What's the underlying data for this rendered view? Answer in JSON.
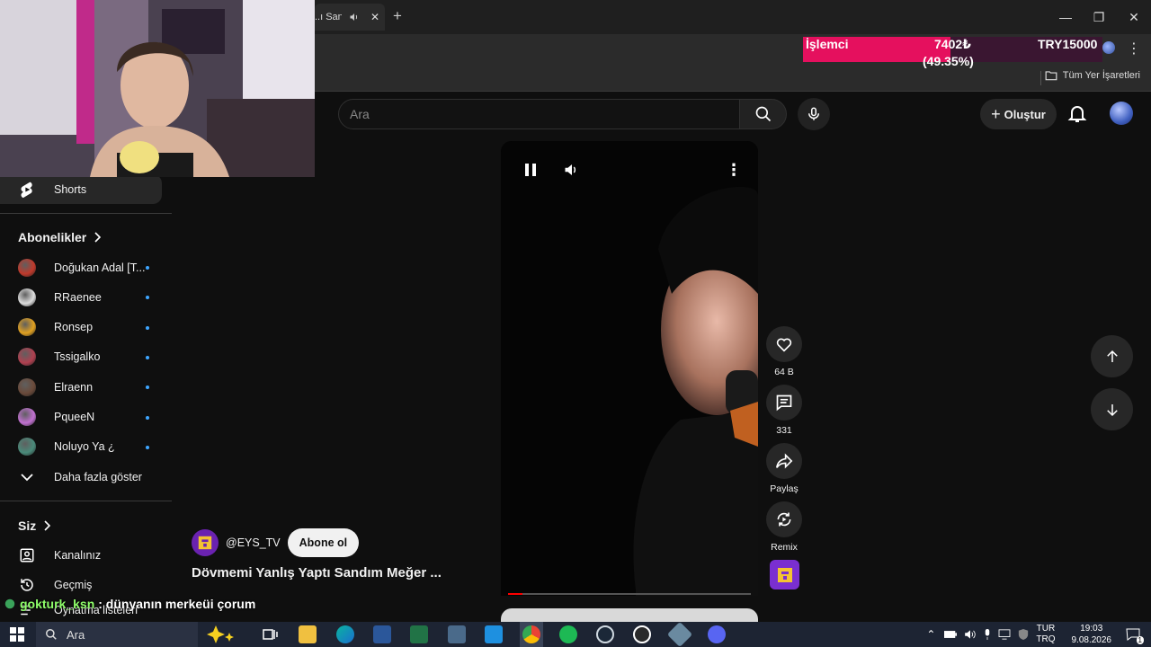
{
  "browser": {
    "tab_title": "..ı Sandı",
    "new_tab": "+",
    "minimize": "—",
    "maximize": "❐",
    "close": "✕",
    "bookmarks_all": "Tüm Yer İşaretleri"
  },
  "overlay": {
    "cpu_label": "İşlemci",
    "cpu_value": "7402₺",
    "cpu_percent": "(49.35%)",
    "cpu_fraction": 0.4935,
    "cpu_target": "TRY15000",
    "chat_user": "gokturk_ksn",
    "chat_message": ": dünyanın merkeüi çorum"
  },
  "header": {
    "search_placeholder": "Ara",
    "create_label": "Oluştur"
  },
  "sidebar": {
    "shorts_label": "Shorts",
    "subscriptions_title": "Abonelikler",
    "subscriptions": [
      {
        "name": "Doğukan Adal [T...",
        "color": "#c0392b"
      },
      {
        "name": "RRaenee",
        "color": "#dddddd"
      },
      {
        "name": "Ronsep",
        "color": "#e0a020"
      },
      {
        "name": "Tssigalko",
        "color": "#b04050"
      },
      {
        "name": "Elraenn",
        "color": "#6a4a3a"
      },
      {
        "name": "PqueeN",
        "color": "#c070d0"
      },
      {
        "name": "Noluyo Ya ¿",
        "color": "#4a8a7a"
      }
    ],
    "show_more": "Daha fazla göster",
    "you_title": "Siz",
    "you_items": [
      {
        "label": "Kanalınız",
        "icon": "channel-icon"
      },
      {
        "label": "Geçmiş",
        "icon": "history-icon"
      },
      {
        "label": "Oynatma listeleri",
        "icon": "playlist-icon"
      }
    ]
  },
  "short": {
    "channel_handle": "@EYS_TV",
    "subscribe_label": "Abone ol",
    "title": "Dövmemi Yanlış Yaptı Sandım Meğer ...",
    "likes": "64 B",
    "comments": "331",
    "share_label": "Paylaş",
    "remix_label": "Remix",
    "progress": 0.06
  },
  "taskbar": {
    "search_label": "Ara",
    "lang_top": "TUR",
    "lang_bottom": "TRQ",
    "time": "19:03",
    "date": "9.08.2026",
    "notif_count": "1"
  }
}
